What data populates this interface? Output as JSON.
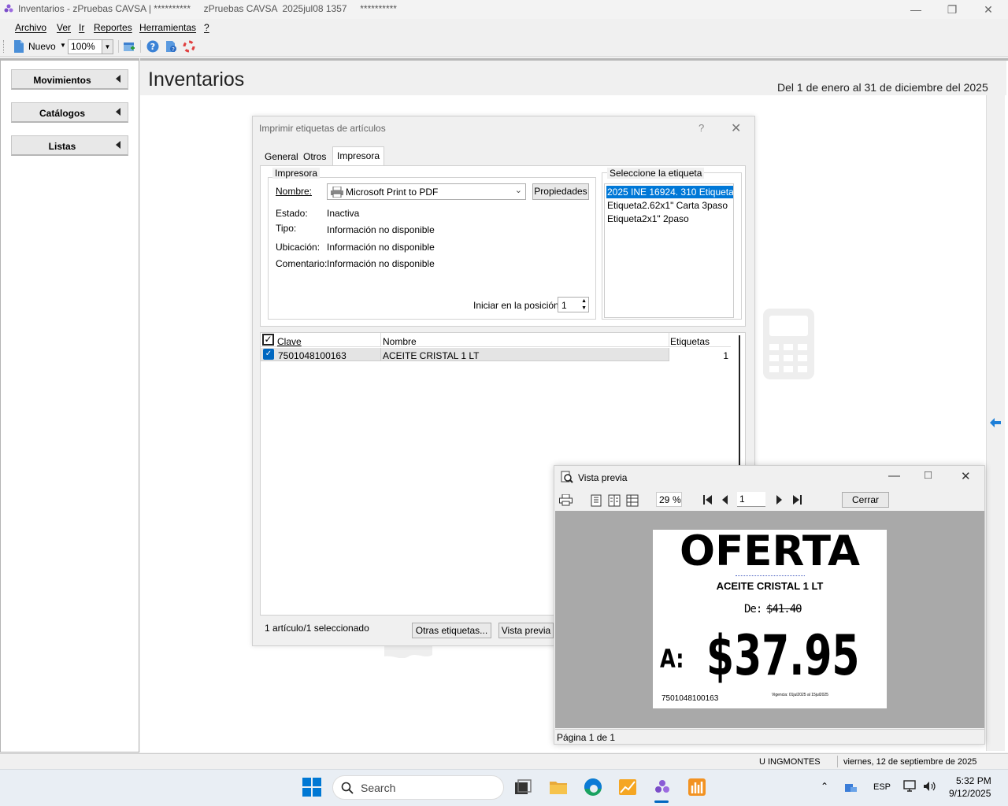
{
  "window": {
    "title": "Inventarios - zPruebas CAVSA | **********     zPruebas CAVSA  2025jul08 1357     **********"
  },
  "menu": [
    "Archivo",
    "Ver",
    "Ir",
    "Reportes",
    "Herramientas",
    "?"
  ],
  "toolbar": {
    "new_label": "Nuevo",
    "zoom": "100%"
  },
  "sidebar": {
    "items": [
      {
        "label": "Movimientos"
      },
      {
        "label": "Catálogos"
      },
      {
        "label": "Listas"
      }
    ]
  },
  "main": {
    "title": "Inventarios",
    "date_range": "Del 1 de enero al 31 de diciembre del 2025"
  },
  "dialog": {
    "title": "Imprimir etiquetas de artículos",
    "help": "?",
    "tabs": [
      "General",
      "Otros",
      "Impresora"
    ],
    "printer_group": "Impresora",
    "name_label": "Nombre:",
    "printer_name": "Microsoft Print to PDF",
    "properties_button": "Propiedades",
    "state_label": "Estado:",
    "state_value": "Inactiva",
    "type_label": "Tipo:",
    "type_value": "Información no disponible",
    "location_label": "Ubicación:",
    "location_value": "Información no disponible",
    "comment_label": "Comentario:",
    "comment_value": "Información no disponible",
    "start_pos_label": "Iniciar en la posición:",
    "start_pos_value": "1",
    "label_group": "Seleccione la etiqueta",
    "labels": [
      "2025 INE 16924. 310 Etiqueta...",
      "Etiqueta2.62x1\" Carta 3paso",
      "Etiqueta2x1\" 2paso"
    ],
    "grid_headers": [
      "Clave",
      "Nombre",
      "Etiquetas"
    ],
    "rows": [
      {
        "clave": "7501048100163",
        "nombre": "ACEITE CRISTAL 1 LT",
        "etiquetas": "1"
      }
    ],
    "summary": "1 artículo/1 seleccionado",
    "other_labels_button": "Otras etiquetas...",
    "preview_button": "Vista previa"
  },
  "preview": {
    "title": "Vista previa",
    "zoom": "29",
    "zoom_unit": "%",
    "page": "1",
    "close_button": "Cerrar",
    "page_status": "Página 1 de 1",
    "label": {
      "headline": "OFERTA",
      "product": "ACEITE CRISTAL 1 LT",
      "from_label": "De:",
      "old_price": "$41.40",
      "to_label": "A:",
      "new_price": "$37.95",
      "barcode": "7501048100163",
      "validity": "Vigencia: 01jul2025 al 15jul2025"
    }
  },
  "status": {
    "user": "U  INGMONTES",
    "date": "viernes, 12 de septiembre de 2025"
  },
  "taskbar": {
    "search_placeholder": "Search",
    "lang": "ESP",
    "time": "5:32 PM",
    "date": "9/12/2025"
  },
  "colors": {
    "selection": "#0078d7",
    "accent_arrow": "#1e7fd8",
    "preview_bg": "#a9a9a9"
  }
}
